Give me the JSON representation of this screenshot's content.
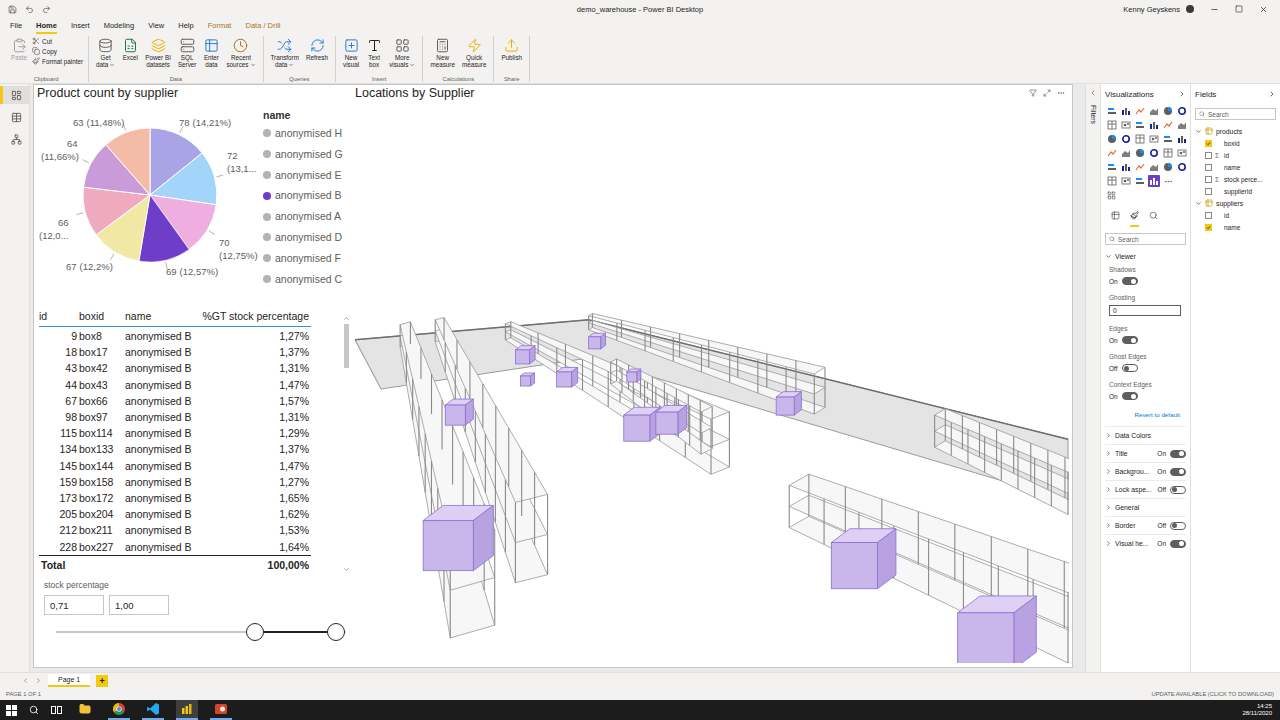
{
  "window": {
    "title": "demo_warehouse - Power BI Desktop",
    "user": "Kenny Geyskens"
  },
  "ribbon_tabs": [
    {
      "label": "File",
      "selected": false,
      "contextual": false
    },
    {
      "label": "Home",
      "selected": true,
      "contextual": false
    },
    {
      "label": "Insert",
      "selected": false,
      "contextual": false
    },
    {
      "label": "Modeling",
      "selected": false,
      "contextual": false
    },
    {
      "label": "View",
      "selected": false,
      "contextual": false
    },
    {
      "label": "Help",
      "selected": false,
      "contextual": false
    },
    {
      "label": "Format",
      "selected": false,
      "contextual": true
    },
    {
      "label": "Data / Drill",
      "selected": false,
      "contextual": true
    }
  ],
  "ribbon_groups": [
    {
      "name": "Clipboard",
      "buttons": [
        {
          "kind": "large",
          "lines": [
            "Paste"
          ],
          "dropdown": false,
          "disabled": true
        },
        {
          "kind": "small",
          "lines": [
            "Cut"
          ],
          "dropdown": false,
          "disabled": false
        },
        {
          "kind": "small",
          "lines": [
            "Copy"
          ],
          "dropdown": false,
          "disabled": false
        },
        {
          "kind": "small",
          "lines": [
            "Format painter"
          ],
          "dropdown": false,
          "disabled": false
        }
      ]
    },
    {
      "name": "Data",
      "buttons": [
        {
          "kind": "large",
          "lines": [
            "Get",
            "data"
          ],
          "dropdown": true,
          "disabled": false
        },
        {
          "kind": "large",
          "lines": [
            "Excel"
          ],
          "dropdown": false,
          "disabled": false
        },
        {
          "kind": "large",
          "lines": [
            "Power BI",
            "datasets"
          ],
          "dropdown": false,
          "disabled": false
        },
        {
          "kind": "large",
          "lines": [
            "SQL",
            "Server"
          ],
          "dropdown": false,
          "disabled": false
        },
        {
          "kind": "large",
          "lines": [
            "Enter",
            "data"
          ],
          "dropdown": false,
          "disabled": false
        },
        {
          "kind": "large",
          "lines": [
            "Recent",
            "sources"
          ],
          "dropdown": true,
          "disabled": false
        }
      ]
    },
    {
      "name": "Queries",
      "buttons": [
        {
          "kind": "large",
          "lines": [
            "Transform",
            "data"
          ],
          "dropdown": true,
          "disabled": false
        },
        {
          "kind": "large",
          "lines": [
            "Refresh"
          ],
          "dropdown": false,
          "disabled": false
        }
      ]
    },
    {
      "name": "Insert",
      "buttons": [
        {
          "kind": "large",
          "lines": [
            "New",
            "visual"
          ],
          "dropdown": false,
          "disabled": false
        },
        {
          "kind": "large",
          "lines": [
            "Text",
            "box"
          ],
          "dropdown": false,
          "disabled": false
        },
        {
          "kind": "large",
          "lines": [
            "More",
            "visuals"
          ],
          "dropdown": true,
          "disabled": false
        }
      ]
    },
    {
      "name": "Calculations",
      "buttons": [
        {
          "kind": "large",
          "lines": [
            "New",
            "measure"
          ],
          "dropdown": false,
          "disabled": false
        },
        {
          "kind": "large",
          "lines": [
            "Quick",
            "measure"
          ],
          "dropdown": false,
          "disabled": false
        }
      ]
    },
    {
      "name": "Share",
      "buttons": [
        {
          "kind": "large",
          "lines": [
            "Publish"
          ],
          "dropdown": false,
          "disabled": false
        }
      ]
    }
  ],
  "nav": [
    {
      "selected": true
    },
    {
      "selected": false
    },
    {
      "selected": false
    }
  ],
  "pie": {
    "title": "Product count by supplier",
    "legend_title": "name",
    "slices": [
      {
        "name": "anonymised H",
        "value": 78,
        "value_text": "78",
        "pct_text": "(14,21%)",
        "color": "#a9a4e6",
        "selected": false
      },
      {
        "name": "anonymised G",
        "value": 72,
        "value_text": "72",
        "pct_text": "(13,1...",
        "color": "#a3d5fa",
        "selected": false
      },
      {
        "name": "anonymised E",
        "value": 70,
        "value_text": "70",
        "pct_text": "(12,75%)",
        "color": "#efaee0",
        "selected": false
      },
      {
        "name": "anonymised B",
        "value": 69,
        "value_text": "69",
        "pct_text": "(12,57%)",
        "color": "#6e3ec9",
        "selected": true
      },
      {
        "name": "anonymised A",
        "value": 67,
        "value_text": "67",
        "pct_text": "(12,2%)",
        "color": "#f2e8a6",
        "selected": false
      },
      {
        "name": "anonymised D",
        "value": 66,
        "value_text": "66",
        "pct_text": "(12,0...",
        "color": "#f0aabf",
        "selected": false
      },
      {
        "name": "anonymised F",
        "value": 64,
        "value_text": "64",
        "pct_text": "(11,66%)",
        "color": "#c99bd8",
        "selected": false
      },
      {
        "name": "anonymised C",
        "value": 63,
        "value_text": "63",
        "pct_text": "(11,48%)",
        "color": "#f4bba6",
        "selected": false
      }
    ]
  },
  "table": {
    "columns": [
      "id",
      "boxid",
      "name",
      "%GT stock percentage"
    ],
    "rows": [
      [
        "9",
        "box8",
        "anonymised B",
        "1,27%"
      ],
      [
        "18",
        "box17",
        "anonymised B",
        "1,37%"
      ],
      [
        "43",
        "box42",
        "anonymised B",
        "1,31%"
      ],
      [
        "44",
        "box43",
        "anonymised B",
        "1,47%"
      ],
      [
        "67",
        "box66",
        "anonymised B",
        "1,57%"
      ],
      [
        "98",
        "box97",
        "anonymised B",
        "1,31%"
      ],
      [
        "115",
        "box114",
        "anonymised B",
        "1,29%"
      ],
      [
        "134",
        "box133",
        "anonymised B",
        "1,37%"
      ],
      [
        "145",
        "box144",
        "anonymised B",
        "1,47%"
      ],
      [
        "159",
        "box158",
        "anonymised B",
        "1,27%"
      ],
      [
        "173",
        "box172",
        "anonymised B",
        "1,65%"
      ],
      [
        "205",
        "box204",
        "anonymised B",
        "1,62%"
      ],
      [
        "212",
        "box211",
        "anonymised B",
        "1,53%"
      ],
      [
        "228",
        "box227",
        "anonymised B",
        "1,64%"
      ]
    ],
    "total": {
      "label": "Total",
      "value": "100,00%"
    }
  },
  "slicer": {
    "title": "stock percentage",
    "low": "0,71",
    "high": "1,00",
    "low_level": 0.71,
    "high_level": 1
  },
  "scene": {
    "title": "Locations by Supplier"
  },
  "filters": {
    "label": "Filters"
  },
  "visualizations": {
    "title": "Visualizations",
    "search": "Search",
    "gallery": [
      {
        "selected": false
      },
      {
        "selected": false
      },
      {
        "selected": false
      },
      {
        "selected": false
      },
      {
        "selected": false
      },
      {
        "selected": false
      },
      {
        "selected": false
      },
      {
        "selected": false
      },
      {
        "selected": false
      },
      {
        "selected": false
      },
      {
        "selected": false
      },
      {
        "selected": false
      },
      {
        "selected": false
      },
      {
        "selected": false
      },
      {
        "selected": false
      },
      {
        "selected": false
      },
      {
        "selected": false
      },
      {
        "selected": false
      },
      {
        "selected": false
      },
      {
        "selected": false
      },
      {
        "selected": false
      },
      {
        "selected": false
      },
      {
        "selected": false
      },
      {
        "selected": false
      },
      {
        "selected": false
      },
      {
        "selected": false
      },
      {
        "selected": false
      },
      {
        "selected": false
      },
      {
        "selected": false
      },
      {
        "selected": false
      },
      {
        "selected": false
      },
      {
        "selected": false
      },
      {
        "selected": false
      },
      {
        "selected": true
      }
    ],
    "pane_tabs": [
      {
        "selected": false
      },
      {
        "selected": true
      },
      {
        "selected": false
      }
    ],
    "section": {
      "label": "Viewer",
      "expanded": true
    },
    "settings": [
      {
        "kind": "toggle",
        "label": "Shadows",
        "value": "On",
        "on": true
      },
      {
        "kind": "input",
        "label": "Ghosting",
        "value": "0"
      },
      {
        "kind": "toggle",
        "label": "Edges",
        "value": "On",
        "on": true
      },
      {
        "kind": "toggle",
        "label": "Ghost Edges",
        "value": "Off",
        "on": false
      },
      {
        "kind": "toggle",
        "label": "Context Edges",
        "value": "On",
        "on": true
      }
    ],
    "revert": "Revert to default",
    "cards": [
      {
        "kind": "section",
        "label": "Data Colors",
        "expanded": false
      },
      {
        "kind": "toggle",
        "label": "Title",
        "value": "On",
        "on": true,
        "expanded": false
      },
      {
        "kind": "toggle",
        "label": "Backgrou...",
        "value": "On",
        "on": true,
        "expanded": false
      },
      {
        "kind": "toggle",
        "label": "Lock aspe...",
        "value": "Off",
        "on": false,
        "expanded": false
      },
      {
        "kind": "section",
        "label": "General",
        "expanded": false
      },
      {
        "kind": "toggle",
        "label": "Border",
        "value": "Off",
        "on": false,
        "expanded": false
      },
      {
        "kind": "toggle",
        "label": "Visual he...",
        "value": "On",
        "on": true,
        "expanded": false
      }
    ]
  },
  "fields": {
    "title": "Fields",
    "search": "Search",
    "tables": [
      {
        "name": "products",
        "expanded": true,
        "fields": [
          {
            "name": "boxid",
            "checked": true,
            "sigma": ""
          },
          {
            "name": "id",
            "checked": false,
            "sigma": "Σ"
          },
          {
            "name": "name",
            "checked": false,
            "sigma": ""
          },
          {
            "name": "stock perce...",
            "checked": false,
            "sigma": "Σ"
          },
          {
            "name": "supplierId",
            "checked": false,
            "sigma": ""
          }
        ]
      },
      {
        "name": "suppliers",
        "expanded": true,
        "fields": [
          {
            "name": "id",
            "checked": false,
            "sigma": ""
          },
          {
            "name": "name",
            "checked": true,
            "sigma": ""
          }
        ]
      }
    ]
  },
  "page_tabs": [
    {
      "label": "Page 1",
      "selected": true
    }
  ],
  "add_page": "+",
  "status_bar": {
    "left": "PAGE 1 OF 1",
    "right": "UPDATE AVAILABLE (CLICK TO DOWNLOAD)"
  },
  "taskbar": {
    "apps": [
      {
        "running": false,
        "active": false
      },
      {
        "running": true,
        "active": false
      },
      {
        "running": true,
        "active": false
      },
      {
        "running": true,
        "active": true
      },
      {
        "running": true,
        "active": false
      }
    ],
    "time": "14:25",
    "date": "28/11/2020"
  }
}
